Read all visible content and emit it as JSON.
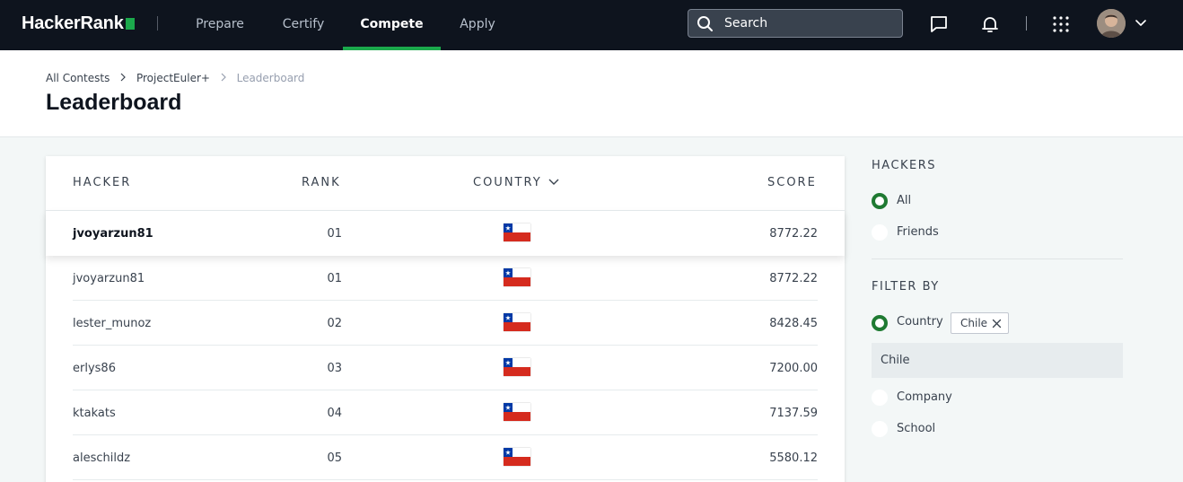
{
  "nav": {
    "logo": "HackerRank",
    "items": [
      {
        "label": "Prepare"
      },
      {
        "label": "Certify"
      },
      {
        "label": "Compete"
      },
      {
        "label": "Apply"
      }
    ],
    "search_placeholder": "Search",
    "accent": "#1ba94c"
  },
  "breadcrumb": [
    "All Contests",
    "ProjectEuler+",
    "Leaderboard"
  ],
  "page_title": "Leaderboard",
  "table": {
    "headers": {
      "hacker": "HACKER",
      "rank": "RANK",
      "country": "COUNTRY",
      "score": "SCORE"
    },
    "rows": [
      {
        "hacker": "jvoyarzun81",
        "rank": "01",
        "country_flag": "chile-flag",
        "score": "8772.22"
      },
      {
        "hacker": "jvoyarzun81",
        "rank": "01",
        "country_flag": "chile-flag",
        "score": "8772.22"
      },
      {
        "hacker": "lester_munoz",
        "rank": "02",
        "country_flag": "chile-flag",
        "score": "8428.45"
      },
      {
        "hacker": "erlys86",
        "rank": "03",
        "country_flag": "chile-flag",
        "score": "7200.00"
      },
      {
        "hacker": "ktakats",
        "rank": "04",
        "country_flag": "chile-flag",
        "score": "7137.59"
      },
      {
        "hacker": "aleschildz",
        "rank": "05",
        "country_flag": "chile-flag",
        "score": "5580.12"
      }
    ]
  },
  "sidebar": {
    "hackers_heading": "HACKERS",
    "hackers_options": [
      {
        "label": "All",
        "selected": true
      },
      {
        "label": "Friends",
        "selected": false
      }
    ],
    "filter_heading": "FILTER BY",
    "filter_options": [
      {
        "label": "Country",
        "selected": true
      },
      {
        "label": "Company",
        "selected": false
      },
      {
        "label": "School",
        "selected": false
      }
    ],
    "country_chip": "Chile",
    "country_suggestion": "Chile",
    "selected_color": "#1f7a32"
  }
}
